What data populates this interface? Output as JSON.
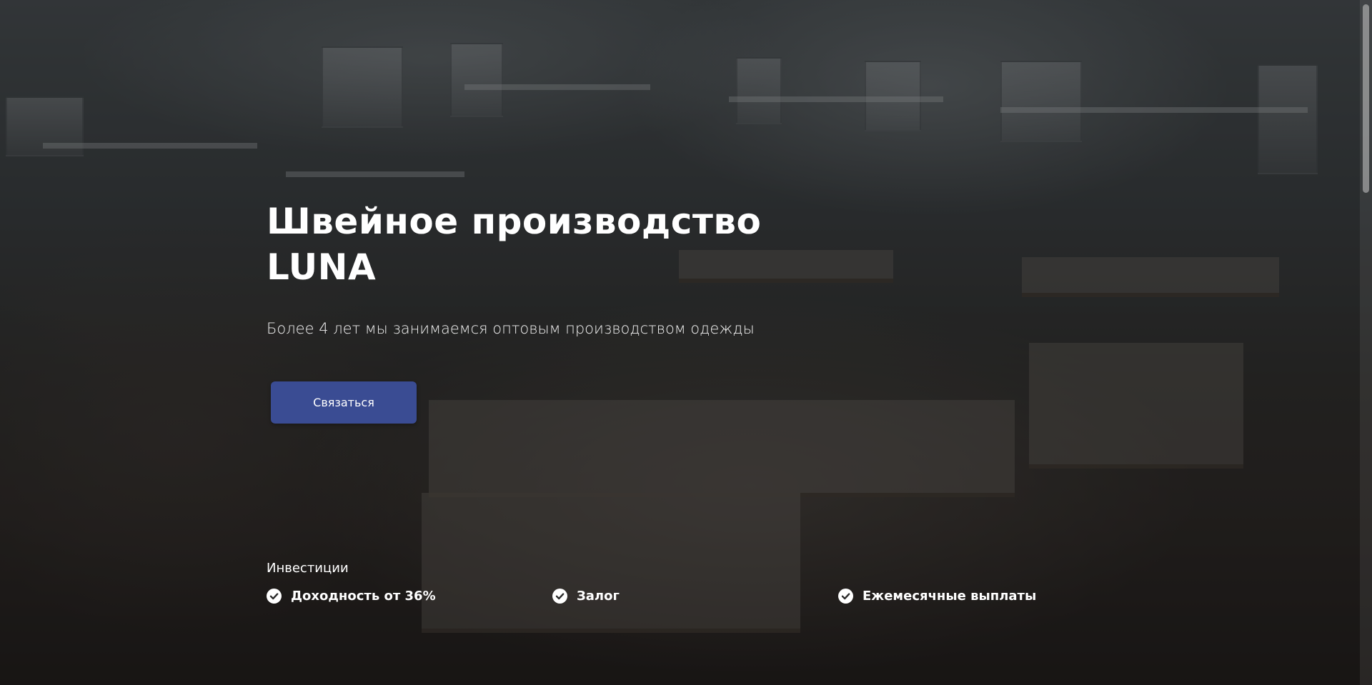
{
  "hero": {
    "title_line1": "Швейное производство",
    "title_line2": "LUNA",
    "subtitle": "Более 4 лет мы занимаемся оптовым производством одежды",
    "cta_label": "Связаться"
  },
  "investments": {
    "label": "Инвестиции",
    "items": [
      {
        "label": "Доходность от 36%",
        "icon": "check-circle-icon"
      },
      {
        "label": "Залог",
        "icon": "check-circle-icon"
      },
      {
        "label": "Ежемесячные выплаты",
        "icon": "check-circle-icon"
      }
    ]
  },
  "colors": {
    "button": "#3a4c93",
    "overlay": "rgba(0,0,0,0.45)",
    "text": "#ffffff"
  }
}
